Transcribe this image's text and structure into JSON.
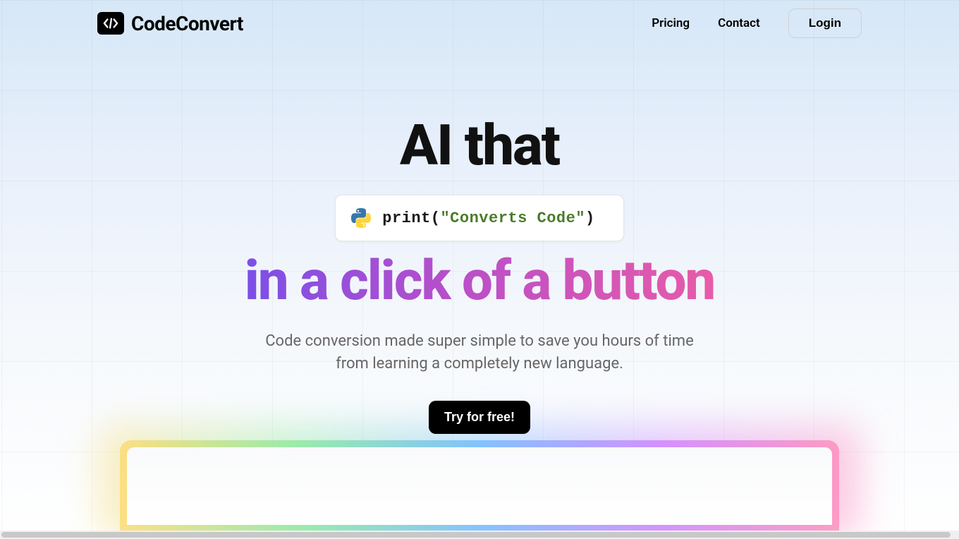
{
  "header": {
    "brand": "CodeConvert",
    "nav": {
      "pricing": "Pricing",
      "contact": "Contact",
      "login": "Login"
    }
  },
  "hero": {
    "line1": "AI that",
    "code": {
      "print": "print",
      "open": "(",
      "string": "\"Converts Code\"",
      "close": ")"
    },
    "line2": "in a click of a button",
    "subtitle": "Code conversion made super simple to save you hours of time from learning a completely new language.",
    "cta": "Try for free!"
  }
}
